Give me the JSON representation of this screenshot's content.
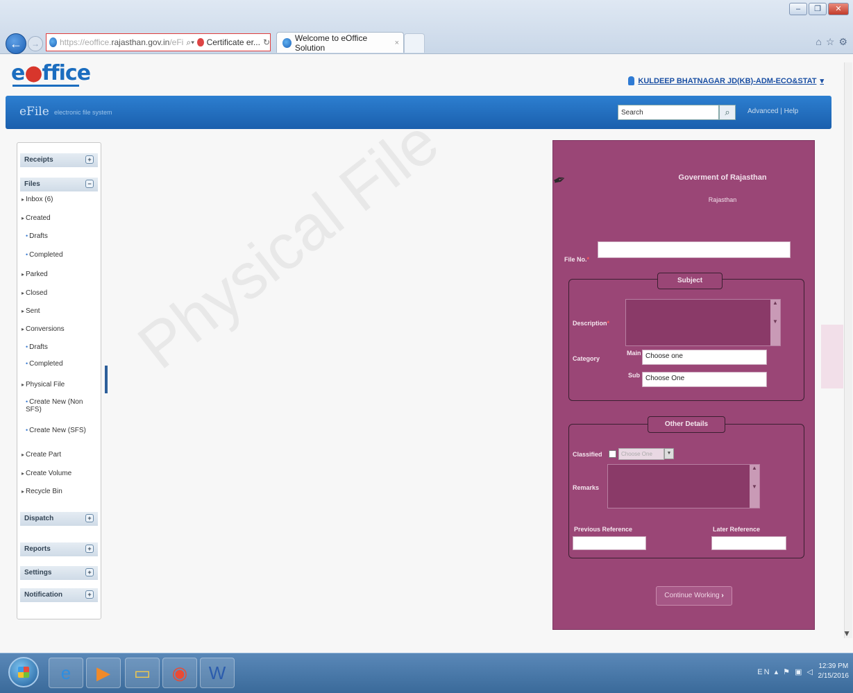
{
  "browser": {
    "url_prefix": "https://eoffice.",
    "url_host": "rajasthan.gov.in",
    "url_rest": "/eFi",
    "cert_text": "Certificate er...",
    "tab_title": "Welcome to eOffice Solution",
    "tab_close": "×"
  },
  "header": {
    "logo": "eOffice",
    "user": "KULDEEP BHATNAGAR  JD(KB)-ADM-ECO&STAT",
    "app_name": "eFile",
    "app_sub": "electronic file system",
    "search_label": "Search",
    "search_value": "",
    "advanced_link": "Advanced",
    "separator": "|",
    "help_link": "Help"
  },
  "sidebar": {
    "sections": {
      "receipts": "Receipts",
      "files": "Files",
      "dispatch": "Dispatch",
      "reports": "Reports",
      "settings": "Settings",
      "notification": "Notification"
    },
    "items": {
      "inbox": "Inbox (6)",
      "created": "Created",
      "created_drafts": "Drafts",
      "created_completed": "Completed",
      "parked": "Parked",
      "closed": "Closed",
      "sent": "Sent",
      "conversions": "Conversions",
      "conv_drafts": "Drafts",
      "conv_completed": "Completed",
      "physical_file": "Physical File",
      "create_new_non_sfs": "Create New (Non SFS)",
      "create_new_sfs": "Create New (SFS)",
      "create_part": "Create Part",
      "create_volume": "Create Volume",
      "recycle_bin": "Recycle Bin"
    }
  },
  "watermark": "Physical File",
  "form": {
    "title": "Goverment of Rajasthan",
    "subtitle": "Rajasthan",
    "file_no_label": "File No.",
    "file_no_value": "",
    "subject_legend": "Subject",
    "description_label": "Description",
    "category_label": "Category",
    "main_label": "Main",
    "main_value": "Choose one",
    "sub_label": "Sub",
    "sub_value": "Choose One",
    "other_details_legend": "Other Details",
    "classified_label": "Classified",
    "classified_select": "Choose One",
    "remarks_label": "Remarks",
    "previous_reference_label": "Previous Reference",
    "later_reference_label": "Later Reference",
    "continue_button": "Continue Working"
  },
  "taskbar": {
    "tray": "EN",
    "time": "12:39 PM",
    "date": "2/15/2016"
  }
}
